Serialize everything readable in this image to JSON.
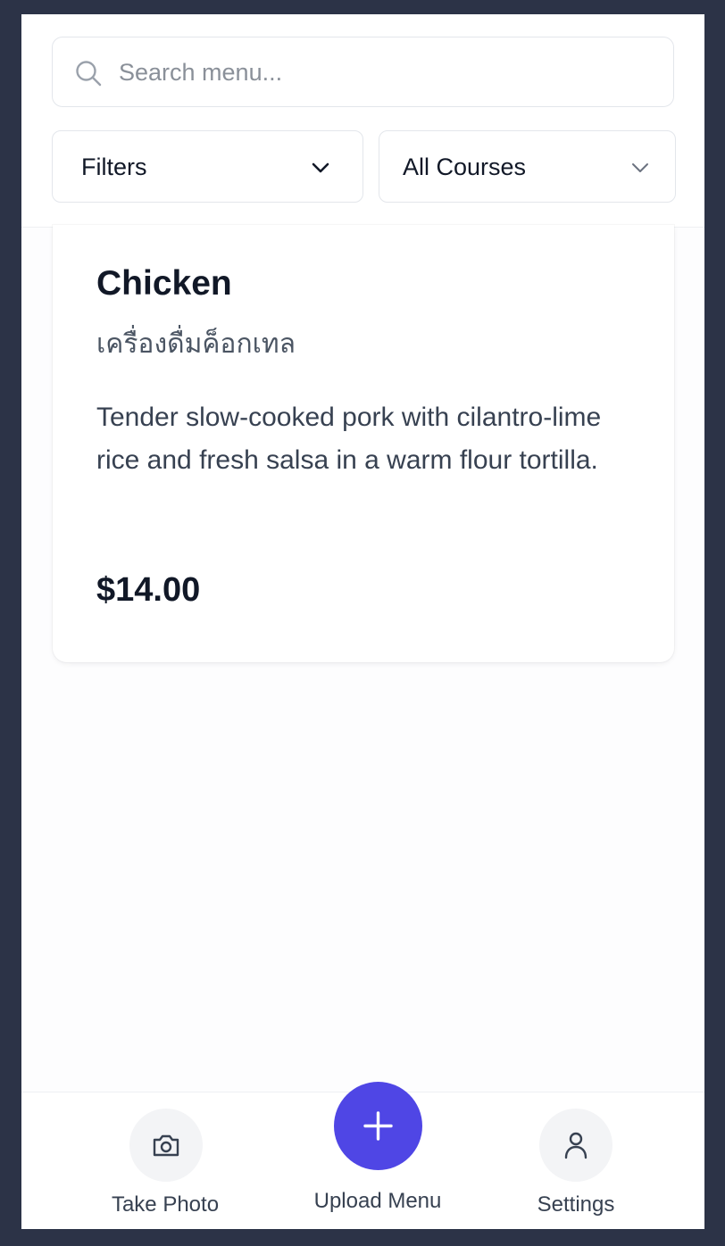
{
  "search": {
    "placeholder": "Search menu..."
  },
  "filters": {
    "filter_label": "Filters",
    "course_label": "All Courses"
  },
  "menu_item": {
    "name": "Chicken",
    "subname": "เครื่องดื่มค็อกเทล",
    "description": "Tender slow-cooked pork with cilantro-lime rice and fresh salsa in a warm flour tortilla.",
    "price": "$14.00"
  },
  "bottom_nav": {
    "take_photo": "Take Photo",
    "upload_menu": "Upload Menu",
    "settings": "Settings"
  },
  "icons": {
    "search": "search-icon",
    "chevron": "chevron-down-icon",
    "camera": "camera-icon",
    "plus": "plus-icon",
    "user": "user-icon"
  },
  "colors": {
    "background": "#2c3347",
    "accent": "#4f46e5",
    "text_primary": "#111827"
  }
}
